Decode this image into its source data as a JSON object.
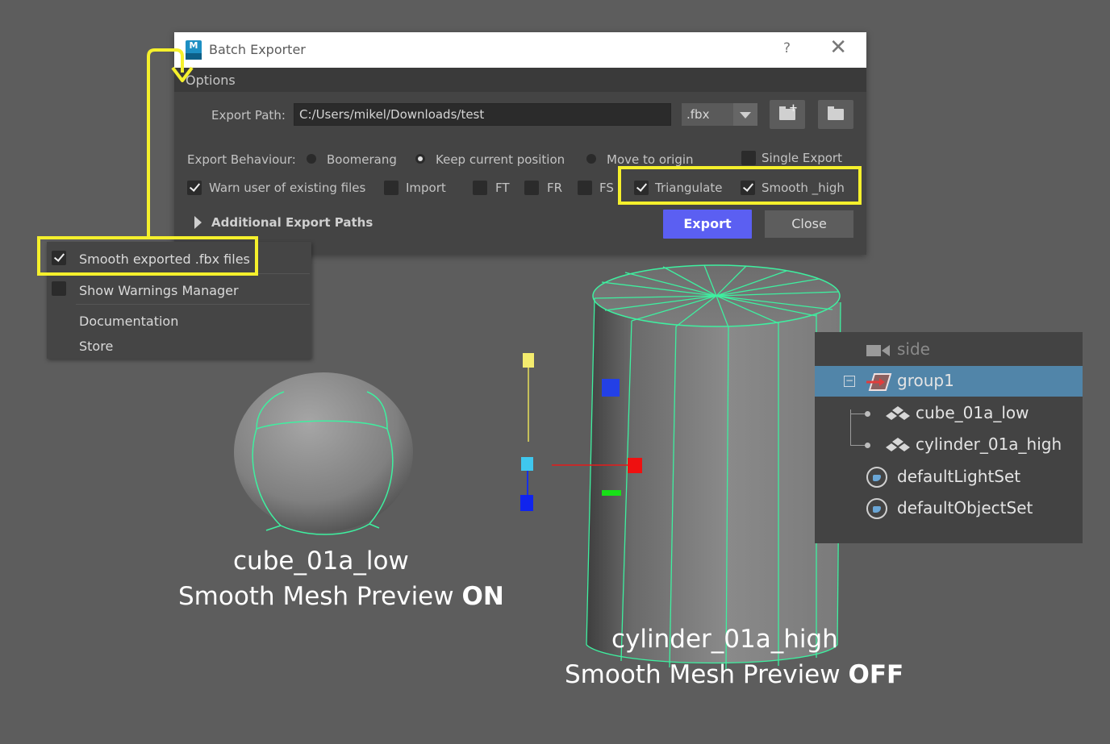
{
  "window": {
    "title": "Batch Exporter",
    "help": "?",
    "menu": "Options"
  },
  "export_path": {
    "label": "Export Path:",
    "value": "C:/Users/mikel/Downloads/test",
    "format": ".fbx"
  },
  "behaviour": {
    "label": "Export Behaviour:",
    "options": [
      "Boomerang",
      "Keep current position",
      "Move to origin"
    ],
    "selected": "Keep current position",
    "single_export": "Single Export"
  },
  "checkboxes": {
    "warn": "Warn user of existing files",
    "import": "Import",
    "ft": "FT",
    "fr": "FR",
    "fs": "FS",
    "triangulate": "Triangulate",
    "smooth": "Smooth _high"
  },
  "additional_paths": "Additional Export Paths",
  "buttons": {
    "export": "Export",
    "close": "Close"
  },
  "options_menu": {
    "smooth_fbx": "Smooth exported .fbx files",
    "warnings": "Show Warnings Manager",
    "documentation": "Documentation",
    "store": "Store"
  },
  "outliner": {
    "camera": "side",
    "group": "group1",
    "child1": "cube_01a_low",
    "child2": "cylinder_01a_high",
    "set1": "defaultLightSet",
    "set2": "defaultObjectSet"
  },
  "captions": {
    "cube_name": "cube_01a_low",
    "cube_state_prefix": "Smooth Mesh Preview ",
    "cube_state": "ON",
    "cyl_name": "cylinder_01a_high",
    "cyl_state_prefix": "Smooth Mesh Preview ",
    "cyl_state": "OFF"
  },
  "colors": {
    "highlight": "#f5f02c",
    "wireframe": "#3ef0a0",
    "export_button": "#5b5ff2",
    "selection": "#5185a9"
  }
}
